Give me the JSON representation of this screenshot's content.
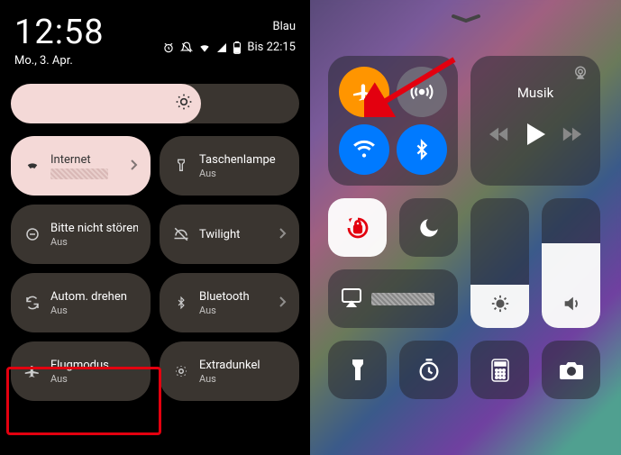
{
  "android": {
    "clock": "12:58",
    "date": "Mo., 3. Apr.",
    "carrier": "Blau",
    "alarm_until": "Bis 22:15",
    "tiles": [
      {
        "title": "Internet",
        "sub": "",
        "active": true,
        "blurred_sub": true,
        "chevron": true
      },
      {
        "title": "Taschenlampe",
        "sub": "Aus"
      },
      {
        "title": "Bitte nicht stören",
        "sub": "Aus"
      },
      {
        "title": "Twilight",
        "sub": "",
        "chevron": true
      },
      {
        "title": "Autom. drehen",
        "sub": "Aus"
      },
      {
        "title": "Bluetooth",
        "sub": "Aus",
        "chevron": true
      },
      {
        "title": "Flugmodus",
        "sub": "Aus",
        "highlighted": true
      },
      {
        "title": "Extradunkel",
        "sub": "Aus"
      }
    ]
  },
  "ios": {
    "music_label": "Musik",
    "brightness_pct": 33,
    "volume_pct": 65
  }
}
